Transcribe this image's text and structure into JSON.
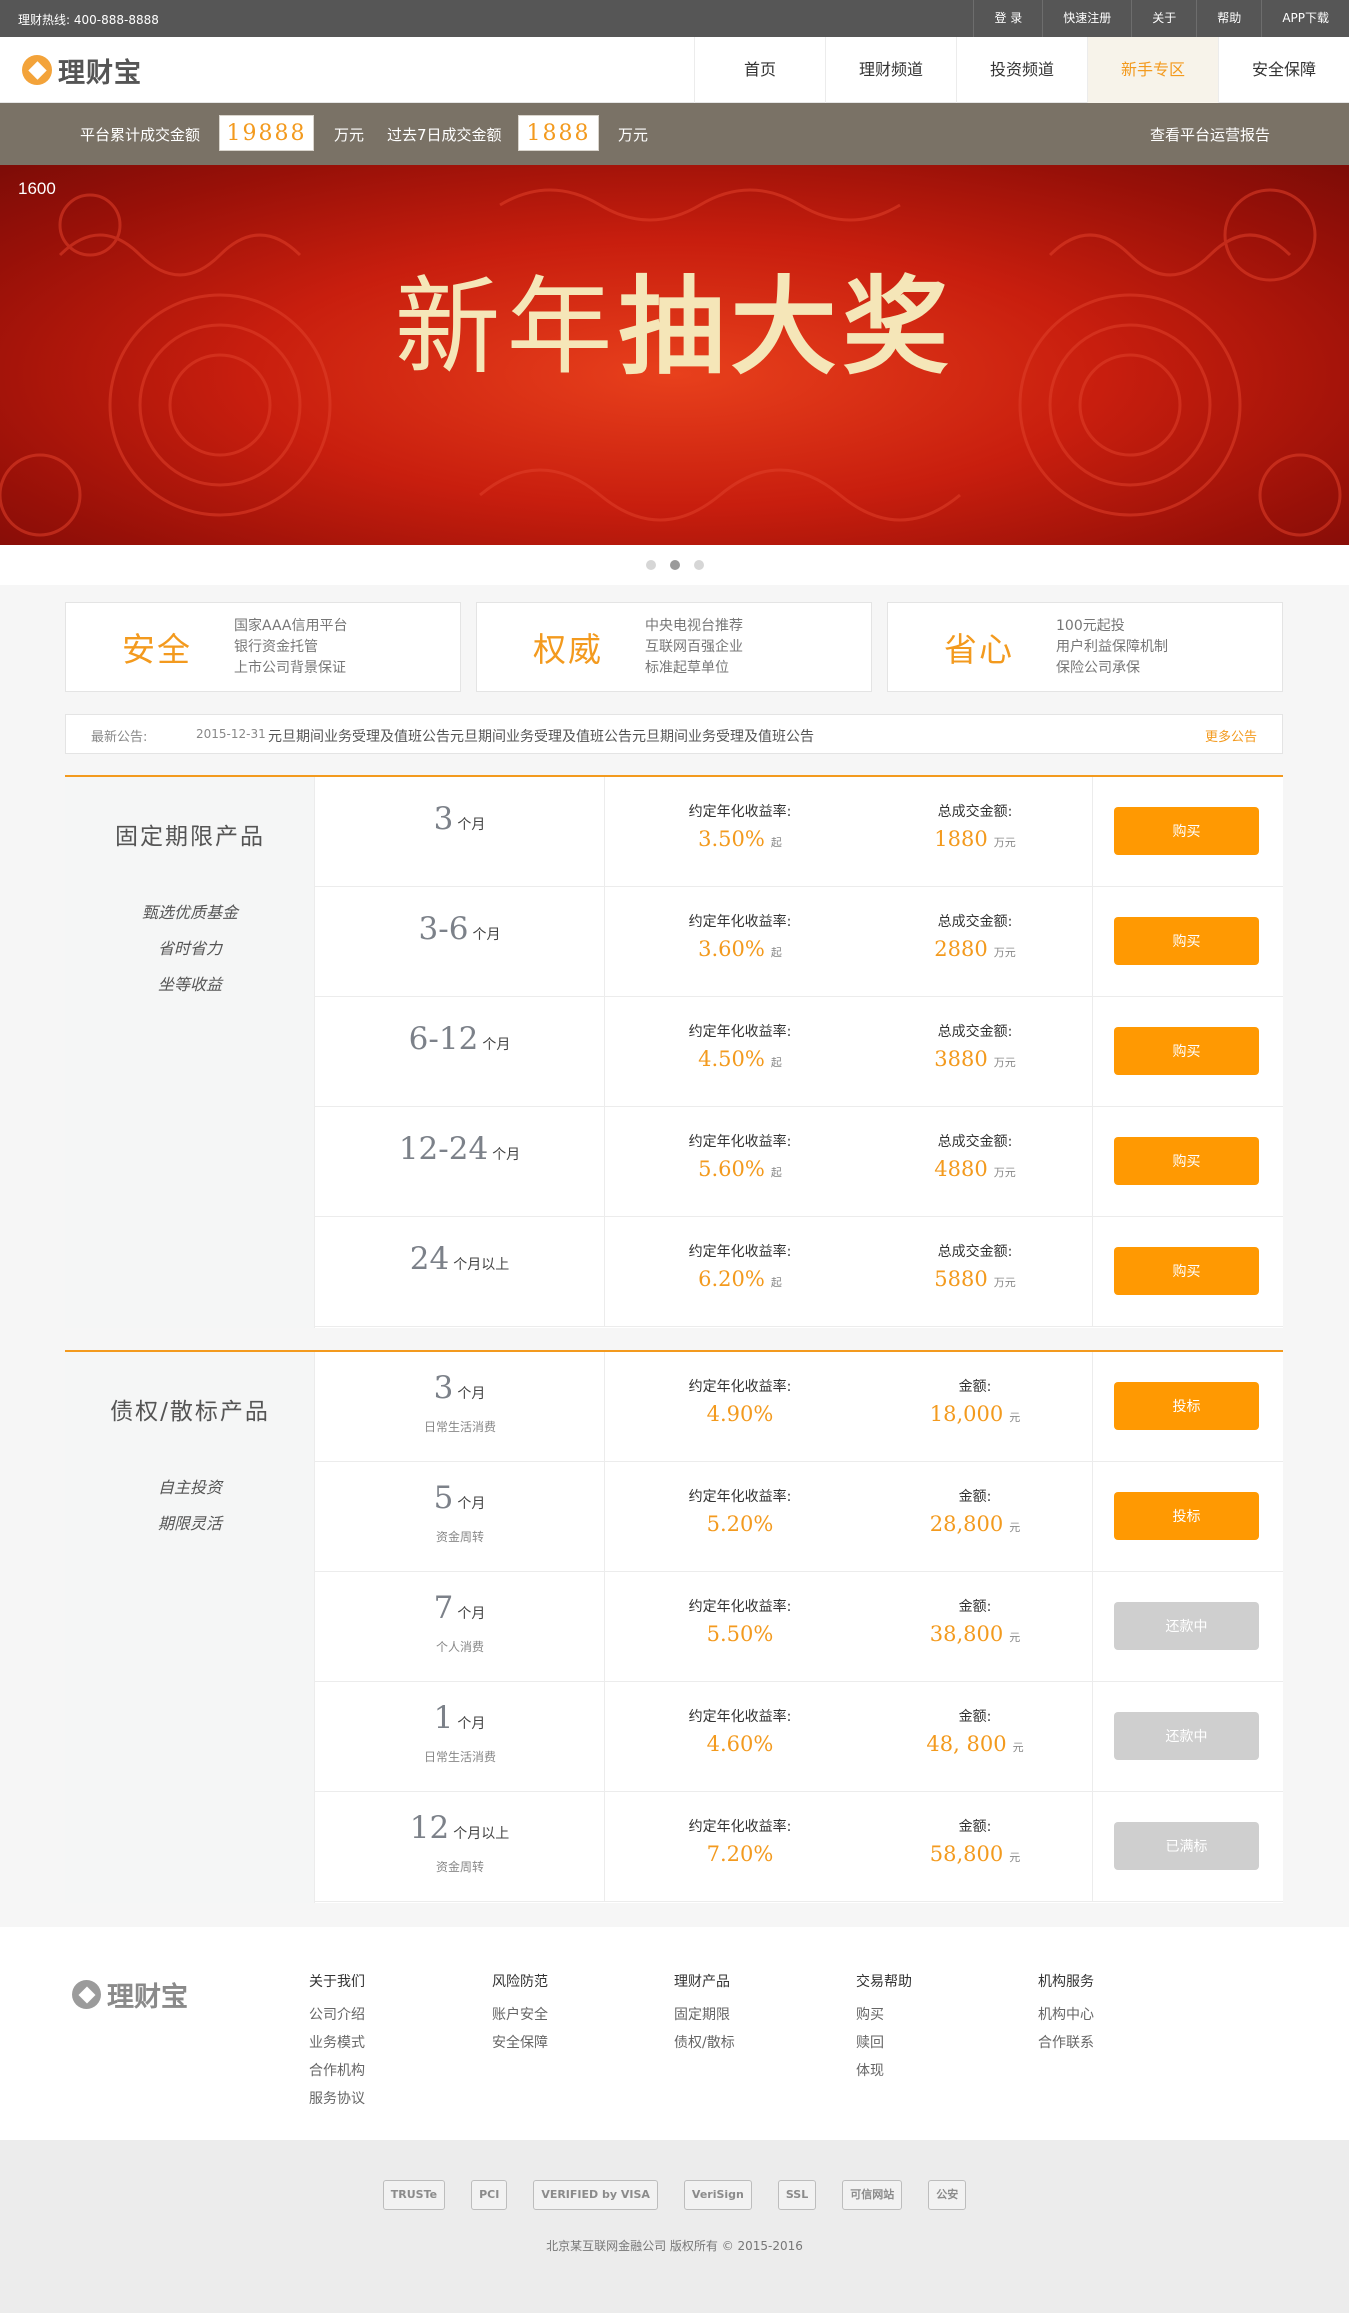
{
  "topbar": {
    "hotline": "理财热线:  400-888-8888",
    "links": [
      "登 录",
      "快速注册",
      "关于",
      "帮助",
      "APP下载"
    ]
  },
  "nav": {
    "logo": "理财宝",
    "items": [
      "首页",
      "理财频道",
      "投资频道",
      "新手专区",
      "安全保障"
    ],
    "active_index": 3
  },
  "stats": {
    "total_label": "平台累计成交金额",
    "total_value": "19888",
    "total_unit": "万元",
    "week_label": "过去7日成交金额",
    "week_value": "1888",
    "week_unit": "万元",
    "report_link": "查看平台运营报告"
  },
  "banner": {
    "counter": "1600",
    "headline_thin": "新年",
    "headline_bold": "抽大奖",
    "dots": 3,
    "active_dot": 1
  },
  "features": [
    {
      "title": "安全",
      "lines": [
        "国家AAA信用平台",
        "银行资金托管",
        "上市公司背景保证"
      ]
    },
    {
      "title": "权威",
      "lines": [
        "中央电视台推荐",
        "互联网百强企业",
        "标准起草单位"
      ]
    },
    {
      "title": "省心",
      "lines": [
        "100元起投",
        "用户利益保障机制",
        "保险公司承保"
      ]
    }
  ],
  "notice": {
    "label": "最新公告:",
    "date": "2015-12-31",
    "text": "元旦期间业务受理及值班公告元旦期间业务受理及值班公告元旦期间业务受理及值班公告",
    "more": "更多公告"
  },
  "fixed": {
    "title": "固定期限产品",
    "tags": [
      "甄选优质基金",
      "省时省力",
      "坐等收益"
    ],
    "rate_label": "约定年化收益率:",
    "amount_label": "总成交金额:",
    "rate_suffix": "起",
    "amount_suffix": "万元",
    "rows": [
      {
        "term": "3",
        "unit": "个月",
        "rate": "3.50%",
        "amount": "1880",
        "button": "购买"
      },
      {
        "term": "3-6",
        "unit": "个月",
        "rate": "3.60%",
        "amount": "2880",
        "button": "购买"
      },
      {
        "term": "6-12",
        "unit": "个月",
        "rate": "4.50%",
        "amount": "3880",
        "button": "购买"
      },
      {
        "term": "12-24",
        "unit": "个月",
        "rate": "5.60%",
        "amount": "4880",
        "button": "购买"
      },
      {
        "term": "24",
        "unit": "个月以上",
        "rate": "6.20%",
        "amount": "5880",
        "button": "购买"
      }
    ]
  },
  "debt": {
    "title": "债权/散标产品",
    "tags": [
      "自主投资",
      "期限灵活"
    ],
    "rate_label": "约定年化收益率:",
    "amount_label": "金额:",
    "amount_suffix": "元",
    "rows": [
      {
        "term": "3",
        "unit": "个月",
        "sub": "日常生活消费",
        "rate": "4.90%",
        "amount": "18,000",
        "button": "投标",
        "state": "active"
      },
      {
        "term": "5",
        "unit": "个月",
        "sub": "资金周转",
        "rate": "5.20%",
        "amount": "28,800",
        "button": "投标",
        "state": "active"
      },
      {
        "term": "7",
        "unit": "个月",
        "sub": "个人消费",
        "rate": "5.50%",
        "amount": "38,800",
        "button": "还款中",
        "state": "disabled"
      },
      {
        "term": "1",
        "unit": "个月",
        "sub": "日常生活消费",
        "rate": "4.60%",
        "amount": "48, 800",
        "button": "还款中",
        "state": "disabled"
      },
      {
        "term": "12",
        "unit": "个月以上",
        "sub": "资金周转",
        "rate": "7.20%",
        "amount": "58,800",
        "button": "已满标",
        "state": "disabled"
      }
    ]
  },
  "footer": {
    "logo": "理财宝",
    "columns": [
      {
        "heading": "关于我们",
        "links": [
          "公司介绍",
          "业务模式",
          "合作机构",
          "服务协议"
        ]
      },
      {
        "heading": "风险防范",
        "links": [
          "账户安全",
          "安全保障"
        ]
      },
      {
        "heading": "理财产品",
        "links": [
          "固定期限",
          "债权/散标"
        ]
      },
      {
        "heading": "交易帮助",
        "links": [
          "购买",
          "赎回",
          "体现"
        ]
      },
      {
        "heading": "机构服务",
        "links": [
          "机构中心",
          "合作联系"
        ]
      }
    ],
    "badges": [
      "TRUSTe",
      "PCI",
      "VERIFIED by VISA",
      "VeriSign",
      "SSL",
      "可信网站",
      "公安"
    ],
    "copyright": "北京某互联网金融公司  版权所有 © 2015-2016"
  },
  "colors": {
    "accent": "#f39a1e",
    "button": "#ff9902",
    "disabled": "#cfcfcf",
    "statbar": "#7a7266",
    "topbar": "#565656"
  }
}
